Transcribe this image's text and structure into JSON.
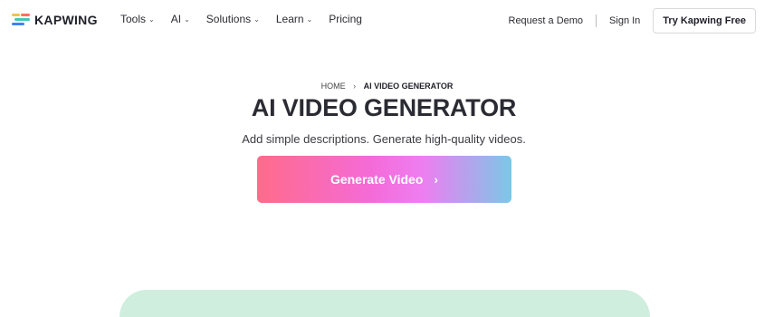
{
  "nav": {
    "logo_text": "KAPWING",
    "menu": [
      {
        "label": "Tools",
        "has_dropdown": true
      },
      {
        "label": "AI",
        "has_dropdown": true
      },
      {
        "label": "Solutions",
        "has_dropdown": true
      },
      {
        "label": "Learn",
        "has_dropdown": true
      },
      {
        "label": "Pricing",
        "has_dropdown": false
      }
    ],
    "request_demo": "Request a Demo",
    "sign_in": "Sign In",
    "try_free": "Try Kapwing Free"
  },
  "breadcrumb": {
    "home": "HOME",
    "separator": "›",
    "current": "AI VIDEO GENERATOR"
  },
  "hero": {
    "title": "AI VIDEO GENERATOR",
    "subtitle": "Add simple descriptions. Generate high-quality videos.",
    "cta_label": "Generate Video",
    "cta_arrow": "›"
  },
  "colors": {
    "logo_bars": [
      "#f2c14e",
      "#ff6f5b",
      "#46c6b8",
      "#3b82f6"
    ],
    "cta_gradient": [
      "#ff6b8a",
      "#f46bd8",
      "#7cc7e8"
    ],
    "band": "#cfeedd"
  }
}
